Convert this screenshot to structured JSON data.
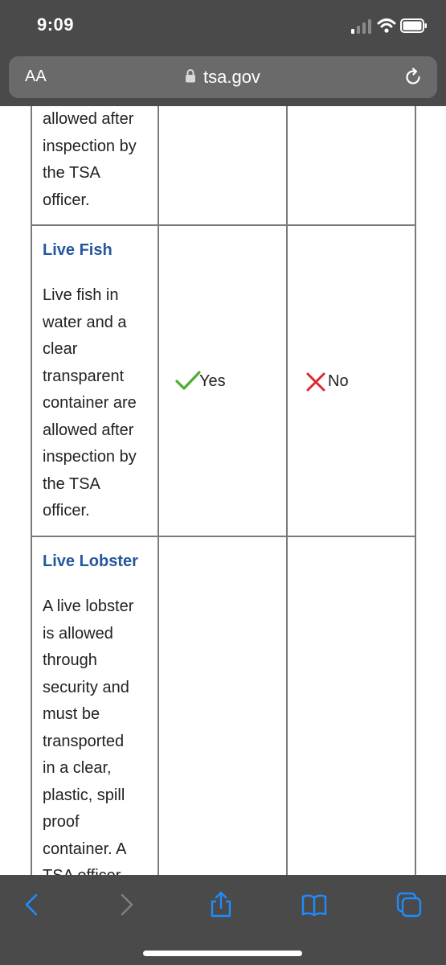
{
  "status_bar": {
    "time": "9:09",
    "icons": [
      "cellular-signal-icon",
      "wifi-icon",
      "battery-icon"
    ]
  },
  "address_bar": {
    "text_size_button": "AA",
    "url": "tsa.gov",
    "icons": [
      "lock-icon",
      "reload-icon"
    ]
  },
  "table": {
    "rows": [
      {
        "name": "",
        "description_lines": [
          "allowed after",
          "inspection by",
          "the TSA",
          "officer."
        ],
        "carry_on": "",
        "checked": ""
      },
      {
        "name": "Live Fish",
        "description_lines": [
          "Live fish in",
          "water and a",
          "clear",
          "transparent",
          "container are",
          "allowed after",
          "inspection by",
          "the TSA",
          "officer."
        ],
        "carry_on": "Yes",
        "checked": "No"
      },
      {
        "name": "Live Lobster",
        "description_lines": [
          "A live lobster",
          "is allowed",
          "through",
          "security and",
          "must be",
          "transported",
          "in a clear,",
          "plastic, spill",
          "proof",
          "container. A",
          "TSA officer"
        ],
        "carry_on": "",
        "checked": ""
      }
    ]
  },
  "colors": {
    "chrome": "#4a4a4a",
    "link_blue": "#24579b",
    "yes_green": "#4caf2a",
    "no_red": "#e0262c"
  },
  "toolbar": {
    "icons": [
      "back-icon",
      "forward-icon",
      "share-icon",
      "bookmarks-icon",
      "tabs-icon"
    ]
  }
}
